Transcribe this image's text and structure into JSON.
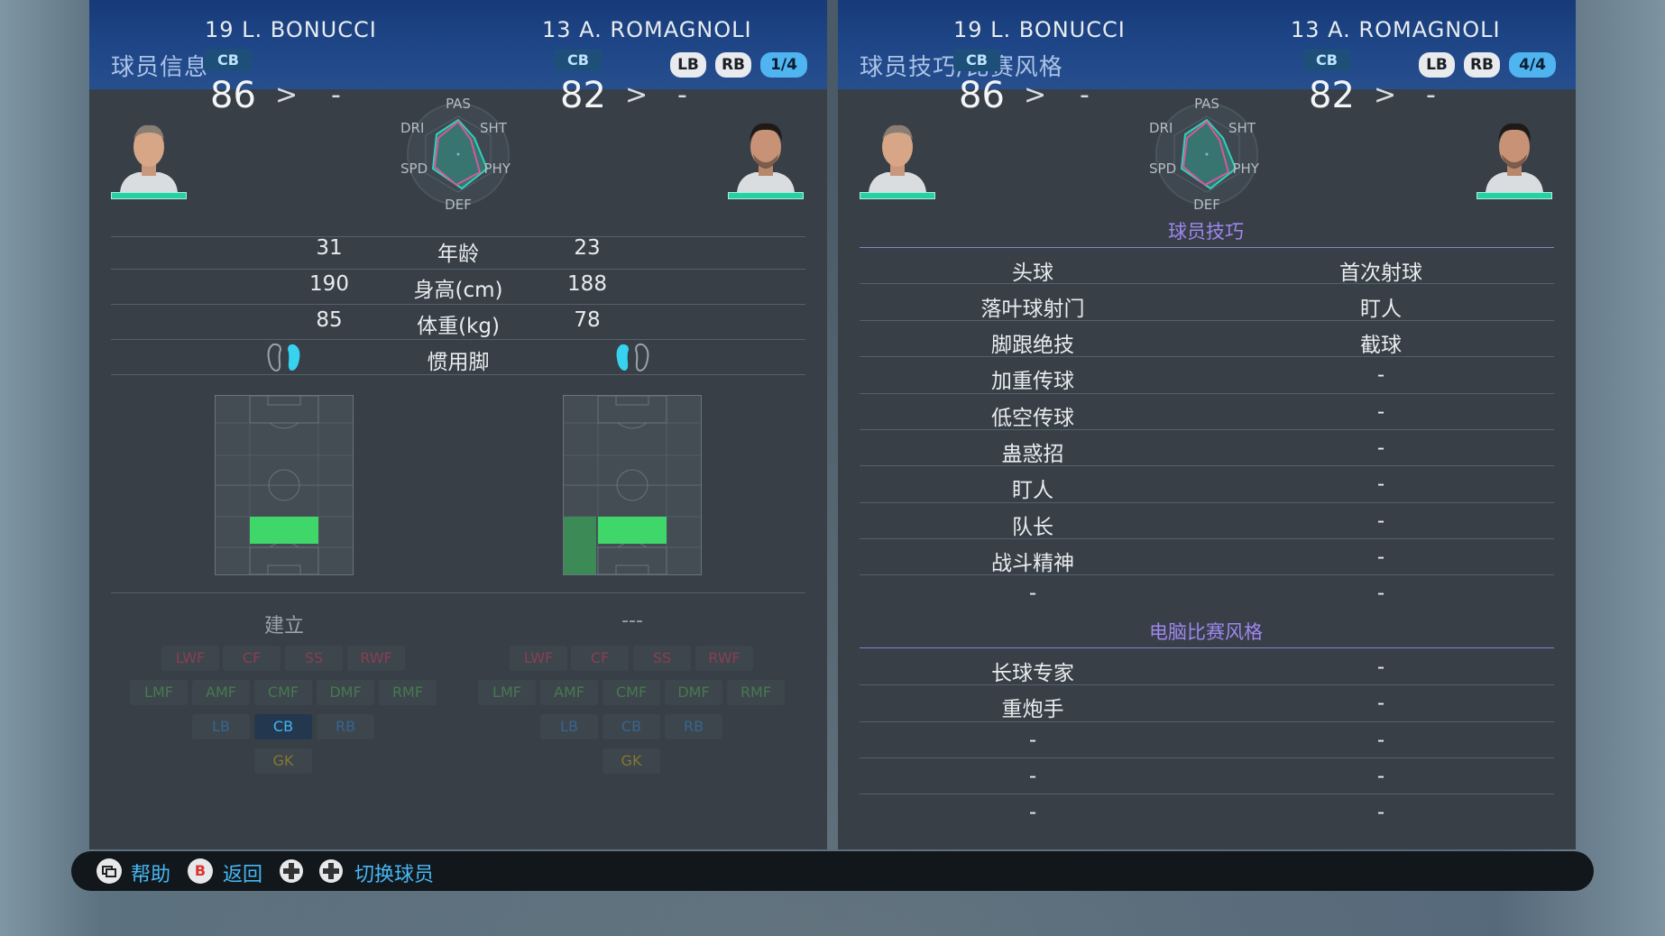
{
  "left_panel": {
    "title": "球员信息",
    "chips": [
      "LB",
      "RB"
    ],
    "page": "1/4"
  },
  "right_panel": {
    "title": "球员技巧/比赛风格",
    "chips": [
      "LB",
      "RB"
    ],
    "page": "4/4"
  },
  "players": [
    {
      "name": "19 L. BONUCCI",
      "position": "CB",
      "rating": "86",
      "arrow": ">",
      "next": "-"
    },
    {
      "name": "13 A. ROMAGNOLI",
      "position": "CB",
      "rating": "82",
      "arrow": ">",
      "next": "-"
    }
  ],
  "radar_labels": {
    "pas": "PAS",
    "sht": "SHT",
    "phy": "PHY",
    "def": "DEF",
    "spd": "SPD",
    "dri": "DRI"
  },
  "stats": [
    {
      "label": "年龄",
      "p1": "31",
      "p2": "23"
    },
    {
      "label": "身高(cm)",
      "p1": "190",
      "p2": "188"
    },
    {
      "label": "体重(kg)",
      "p1": "85",
      "p2": "78"
    },
    {
      "label": "惯用脚",
      "p1": "",
      "p2": ""
    }
  ],
  "stronger_foot": {
    "p1": "right",
    "p2": "left"
  },
  "playing_style": {
    "p1": "建立",
    "p2": "---"
  },
  "position_grid": {
    "forwards": [
      "LWF",
      "CF",
      "SS",
      "RWF"
    ],
    "midfielders": [
      "LMF",
      "AMF",
      "CMF",
      "DMF",
      "RMF"
    ],
    "defenders": [
      "LB",
      "CB",
      "RB"
    ],
    "goalkeeper": [
      "GK"
    ]
  },
  "active_position": {
    "p1": "CB",
    "p2": ""
  },
  "skills_section": {
    "header": "球员技巧",
    "rows": [
      {
        "p1": "头球",
        "p2": "首次射球"
      },
      {
        "p1": "落叶球射门",
        "p2": "盯人"
      },
      {
        "p1": "脚跟绝技",
        "p2": "截球"
      },
      {
        "p1": "加重传球",
        "p2": "-"
      },
      {
        "p1": "低空传球",
        "p2": "-"
      },
      {
        "p1": "蛊惑招",
        "p2": "-"
      },
      {
        "p1": "盯人",
        "p2": "-"
      },
      {
        "p1": "队长",
        "p2": "-"
      },
      {
        "p1": "战斗精神",
        "p2": "-"
      },
      {
        "p1": "-",
        "p2": "-"
      }
    ]
  },
  "ai_styles_section": {
    "header": "电脑比赛风格",
    "rows": [
      {
        "p1": "长球专家",
        "p2": "-"
      },
      {
        "p1": "重炮手",
        "p2": "-"
      },
      {
        "p1": "-",
        "p2": "-"
      },
      {
        "p1": "-",
        "p2": "-"
      },
      {
        "p1": "-",
        "p2": "-"
      }
    ]
  },
  "footer": {
    "help": "帮助",
    "back_key": "B",
    "back": "返回",
    "switch": "切换球员"
  },
  "colors": {
    "header_blue": "#1f4788",
    "panel": "#383f46",
    "accent_cyan": "#47b7f3",
    "stamina_green": "#27d0a2",
    "position_green": "#3fd66a",
    "section_purple": "#9e86f0"
  }
}
